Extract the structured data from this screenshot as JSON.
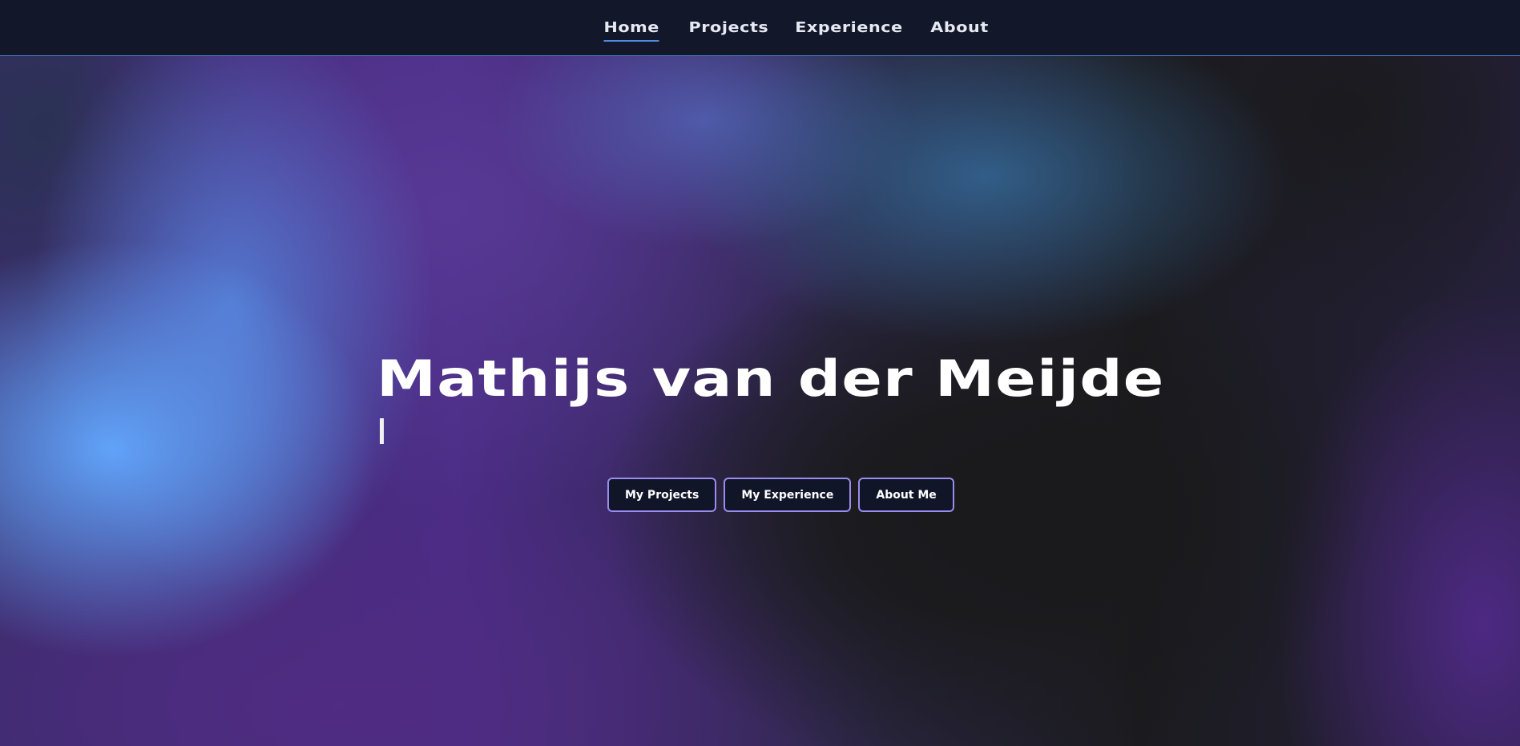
{
  "nav": {
    "items": [
      {
        "label": "Home",
        "active": true
      },
      {
        "label": "Projects",
        "active": false
      },
      {
        "label": "Experience",
        "active": false
      },
      {
        "label": "About",
        "active": false
      }
    ]
  },
  "hero": {
    "title": "Mathijs van der Meijde",
    "typed_text": ""
  },
  "buttons": {
    "projects_label": "My Projects",
    "experience_label": "My Experience",
    "about_label": "About Me"
  },
  "colors": {
    "nav_background": "#121829",
    "nav_underline": "#4c8ce0",
    "button_border": "#9a8cf0",
    "button_background": "#111528"
  }
}
